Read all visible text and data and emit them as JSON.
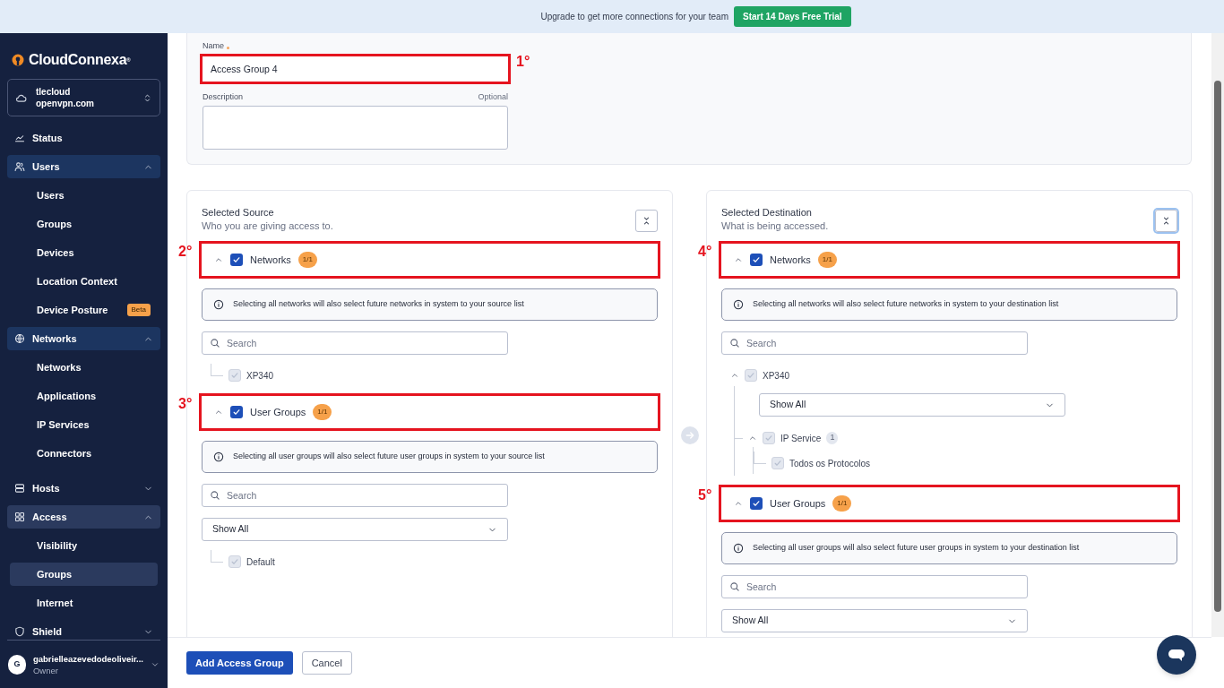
{
  "banner": {
    "text": "Upgrade to get more connections for your team",
    "button": "Start 14 Days Free Trial"
  },
  "sidebar": {
    "logo": "CloudConnexa$^{®}$",
    "workspace": {
      "name": "tlecloud",
      "domain": "openvpn.com"
    },
    "nav": [
      {
        "label": "Status"
      },
      {
        "label": "Users",
        "expanded": true,
        "children": [
          {
            "label": "Users",
            "selected": false
          },
          {
            "label": "Groups",
            "selected": false
          },
          {
            "label": "Devices",
            "selected": false
          },
          {
            "label": "Location Context",
            "selected": false
          },
          {
            "label": "Device Posture",
            "badge": "Beta",
            "selected": false
          }
        ]
      },
      {
        "label": "Networks",
        "expanded": true,
        "children": [
          {
            "label": "Networks",
            "selected": false
          },
          {
            "label": "Applications",
            "selected": false
          },
          {
            "label": "IP Services",
            "selected": false
          },
          {
            "label": "Connectors",
            "selected": false
          }
        ]
      },
      {
        "label": "Hosts",
        "expanded": false
      },
      {
        "label": "Access",
        "expanded": true,
        "children": [
          {
            "label": "Visibility",
            "selected": false
          },
          {
            "label": "Groups",
            "selected": true
          },
          {
            "label": "Internet",
            "selected": false
          }
        ]
      },
      {
        "label": "Shield",
        "expanded": false
      }
    ],
    "user": {
      "initial": "G",
      "name": "gabrielleazevedodeoliveir...",
      "role": "Owner"
    }
  },
  "form": {
    "name_label": "Name",
    "name_required": true,
    "name_value": "Access Group 4",
    "name_annotation": "1°",
    "description_label": "Description",
    "description_hint": "Optional"
  },
  "panels": [
    {
      "title": "Selected Source",
      "subtitle": "Who you are giving access to.",
      "sections": [
        {
          "label": "Networks",
          "checked": true,
          "expanded": true,
          "count": "1/1",
          "annotation": "2°",
          "info": "Selecting all networks will also select future networks in system to your source list",
          "search_placeholder": "Search",
          "items": [
            {
              "label": "XP340",
              "checked": true
            }
          ]
        },
        {
          "label": "User Groups",
          "checked": true,
          "expanded": true,
          "count": "1/1",
          "annotation": "3°",
          "info": "Selecting all user groups will also select future user groups in system to your source list",
          "search_placeholder": "Search",
          "filter": "Show All",
          "items": [
            {
              "label": "Default",
              "checked": true
            }
          ]
        }
      ]
    },
    {
      "title": "Selected Destination",
      "subtitle": "What is being accessed.",
      "sections": [
        {
          "label": "Networks",
          "checked": true,
          "expanded": true,
          "count": "1/1",
          "annotation": "4°",
          "info": "Selecting all networks will also select future networks in system to your destination list",
          "search_placeholder": "Search",
          "items": [
            {
              "label": "XP340",
              "checked": true,
              "expanded": true,
              "filter": "Show All",
              "children": [
                {
                  "label": "IP Service",
                  "checked": true,
                  "expanded": true,
                  "count": "1",
                  "children": [
                    {
                      "label": "Todos os Protocolos",
                      "checked": true
                    }
                  ]
                }
              ]
            }
          ]
        },
        {
          "label": "User Groups",
          "checked": true,
          "expanded": true,
          "count": "1/1",
          "annotation": "5°",
          "info": "Selecting all user groups will also select future user groups in system to your destination list",
          "search_placeholder": "Search",
          "filter": "Show All"
        }
      ]
    }
  ],
  "footer": {
    "primary": "Add Access Group",
    "secondary": "Cancel"
  }
}
